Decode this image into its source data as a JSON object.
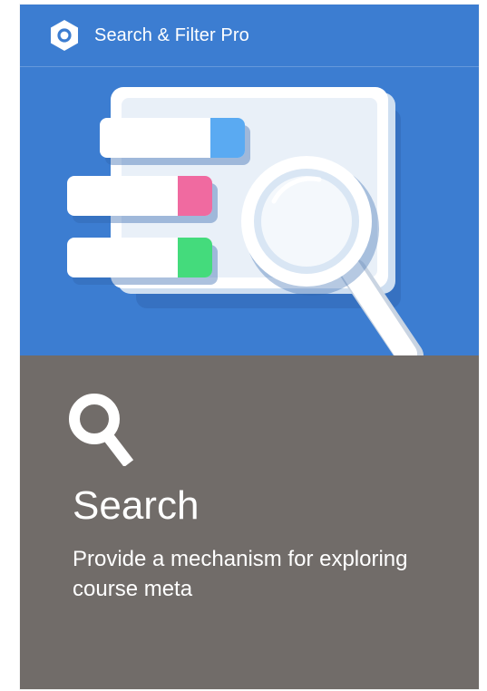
{
  "brand": {
    "name": "Search & Filter Pro",
    "logo_icon": "hexagon-ring-icon"
  },
  "hero": {
    "illustration": "search-filter-illustration",
    "background_color": "#3c7dd1",
    "filter_colors": [
      "#5aaaf2",
      "#f06aa0",
      "#44db7c"
    ]
  },
  "feature": {
    "icon": "magnifier-icon",
    "title": "Search",
    "description": "Provide a mechanism for exploring course meta",
    "background_color": "#716c69"
  }
}
